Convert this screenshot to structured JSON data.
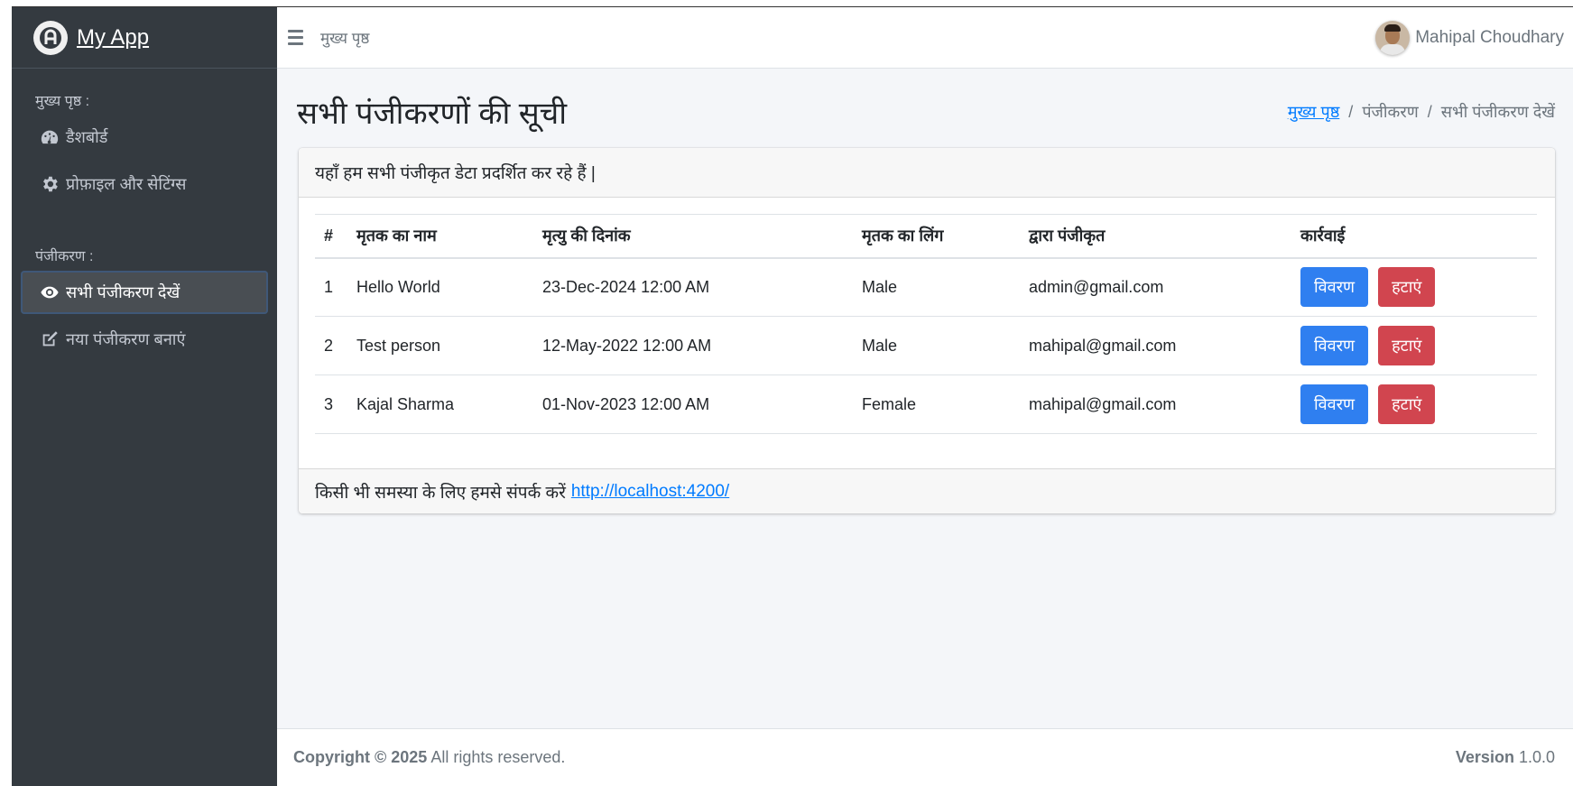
{
  "brand": {
    "name": "My App"
  },
  "sidebar": {
    "section1": "मुख्य पृष्ठ :",
    "items1": [
      {
        "label": "डैशबोर्ड",
        "icon": "dashboard-icon"
      },
      {
        "label": "प्रोफ़ाइल और सेटिंग्स",
        "icon": "gear-icon"
      }
    ],
    "section2": "पंजीकरण :",
    "items2": [
      {
        "label": "सभी पंजीकरण देखें",
        "icon": "eye-icon",
        "active": true
      },
      {
        "label": "नया पंजीकरण बनाएं",
        "icon": "edit-icon"
      }
    ]
  },
  "topbar": {
    "home_link": "मुख्य पृष्ठ",
    "user_name": "Mahipal Choudhary"
  },
  "page": {
    "title": "सभी पंजीकरणों की सूची",
    "breadcrumb": [
      "मुख्य पृष्ठ",
      "पंजीकरण",
      "सभी पंजीकरण देखें"
    ]
  },
  "card": {
    "header": "यहाँ हम सभी पंजीकृत डेटा प्रदर्शित कर रहे हैं |",
    "columns": [
      "#",
      "मृतक का नाम",
      "मृत्यु की दिनांक",
      "मृतक का लिंग",
      "द्वारा पंजीकृत",
      "कार्रवाई"
    ],
    "rows": [
      {
        "no": "1",
        "name": "Hello World",
        "date": "23-Dec-2024 12:00 AM",
        "gender": "Male",
        "by": "admin@gmail.com"
      },
      {
        "no": "2",
        "name": "Test person",
        "date": "12-May-2022 12:00 AM",
        "gender": "Male",
        "by": "mahipal@gmail.com"
      },
      {
        "no": "3",
        "name": "Kajal Sharma",
        "date": "01-Nov-2023 12:00 AM",
        "gender": "Female",
        "by": "mahipal@gmail.com"
      }
    ],
    "view_label": "विवरण",
    "delete_label": "हटाएं",
    "footer_text": "किसी भी समस्या के लिए हमसे संपर्क करें",
    "footer_link": "http://localhost:4200/"
  },
  "footer": {
    "copyright_bold": "Copyright © 2025",
    "copyright_rest": "All rights reserved.",
    "version_label": "Version",
    "version_value": "1.0.0"
  },
  "colors": {
    "sidebar_bg": "#343a40",
    "primary": "#2f7ff0",
    "danger": "#d1454f",
    "link": "#007bff"
  }
}
